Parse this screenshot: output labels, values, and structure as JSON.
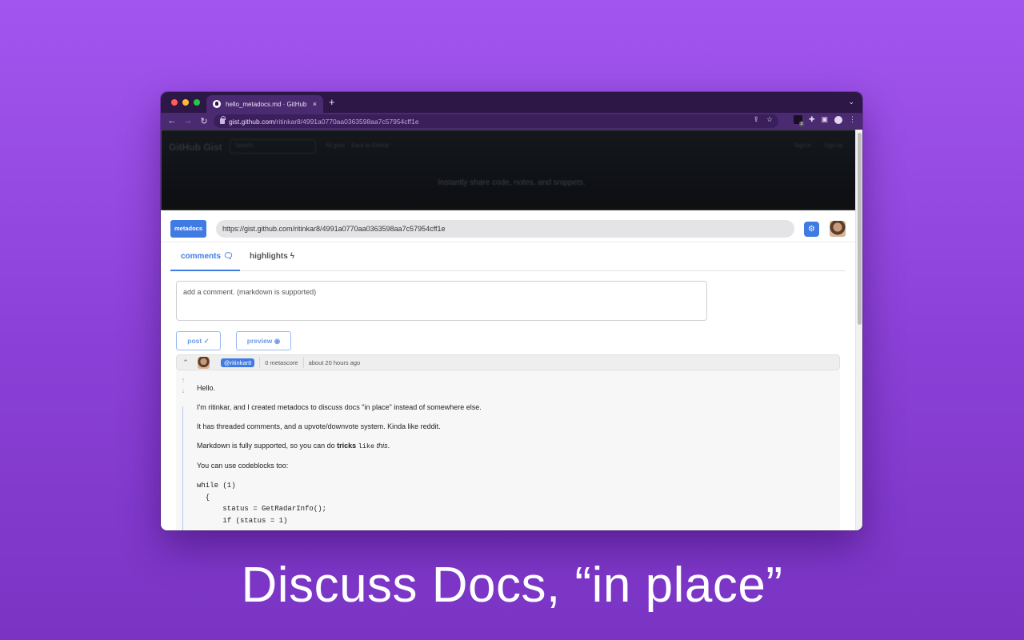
{
  "browser": {
    "tab_title": "hello_metadocs.md · GitHub",
    "tab_close": "×",
    "new_tab": "+",
    "url_host": "gist.github.com",
    "url_path": "/ritinkar8/4991a0770aa0363598aa7c57954cff1e",
    "back": "←",
    "forward": "→",
    "reload": "C"
  },
  "gist_header": {
    "logo": "GitHub Gist",
    "search_placeholder": "Search...",
    "nav": [
      "All gists",
      "Back to GitHub"
    ],
    "sign_in": "Sign in",
    "sign_up": "Sign up",
    "tagline": "Instantly share code, notes, and snippets."
  },
  "panel": {
    "brand": "metadocs",
    "url": "https://gist.github.com/ritinkar8/4991a0770aa0363598aa7c57954cff1e",
    "settings_icon": "⚙",
    "tabs": {
      "comments": "comments",
      "highlights": "highlights"
    },
    "comment_placeholder": "add a comment. (markdown is supported)",
    "post_label": "post",
    "preview_label": "preview"
  },
  "comment": {
    "username": "@ritinkar8",
    "metascore": "0 metascore",
    "time": "about 20 hours ago",
    "paragraphs": [
      "Hello.",
      "I'm ritinkar, and I created metadocs to discuss docs \"in place\" instead of somewhere else.",
      "It has threaded comments, and a upvote/downvote system. Kinda like reddit."
    ],
    "md_prefix": "Markdown is fully supported, so you can do ",
    "md_bold": "tricks",
    "md_code": "like",
    "md_italic": "this",
    "md_suffix": ".",
    "codeblock_intro": "You can use codeblocks too:",
    "code": "while (1)\n  {\n      status = GetRadarInfo();\n      if (status = 1)"
  },
  "caption": "Discuss Docs, “in place”",
  "colors": {
    "background": "#a356ef",
    "accent": "#3f7be3",
    "browser_chrome": "#2c1747"
  }
}
